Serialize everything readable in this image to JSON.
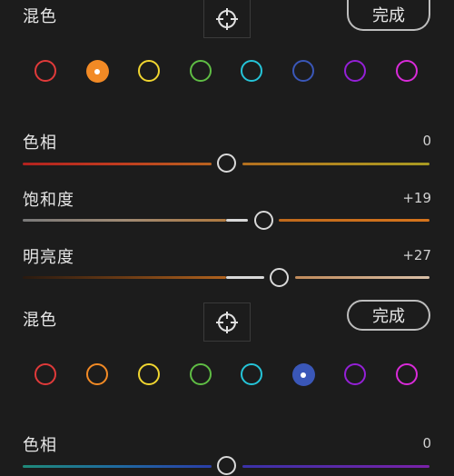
{
  "sections": [
    {
      "title": "混色",
      "done_label": "完成",
      "swatches": [
        {
          "name": "red",
          "color": "#e03a3a",
          "selected": false
        },
        {
          "name": "orange",
          "color": "#f28a25",
          "selected": true
        },
        {
          "name": "yellow",
          "color": "#f0d530",
          "selected": false
        },
        {
          "name": "green",
          "color": "#5fbd44",
          "selected": false
        },
        {
          "name": "aqua",
          "color": "#25c4d8",
          "selected": false
        },
        {
          "name": "blue",
          "color": "#3a57b8",
          "selected": false
        },
        {
          "name": "purple",
          "color": "#9420d6",
          "selected": false
        },
        {
          "name": "magenta",
          "color": "#d92bd9",
          "selected": false
        }
      ],
      "sliders": [
        {
          "label": "色相",
          "value": "0"
        },
        {
          "label": "饱和度",
          "value": "+19"
        },
        {
          "label": "明亮度",
          "value": "+27"
        }
      ]
    },
    {
      "title": "混色",
      "done_label": "完成",
      "swatches": [
        {
          "name": "red",
          "color": "#e03a3a",
          "selected": false
        },
        {
          "name": "orange",
          "color": "#f28a25",
          "selected": false
        },
        {
          "name": "yellow",
          "color": "#f0d530",
          "selected": false
        },
        {
          "name": "green",
          "color": "#5fbd44",
          "selected": false
        },
        {
          "name": "aqua",
          "color": "#25c4d8",
          "selected": false
        },
        {
          "name": "blue",
          "color": "#3a57b8",
          "selected": true
        },
        {
          "name": "purple",
          "color": "#9420d6",
          "selected": false
        },
        {
          "name": "magenta",
          "color": "#d92bd9",
          "selected": false
        }
      ],
      "sliders": [
        {
          "label": "色相",
          "value": "0"
        }
      ]
    }
  ]
}
